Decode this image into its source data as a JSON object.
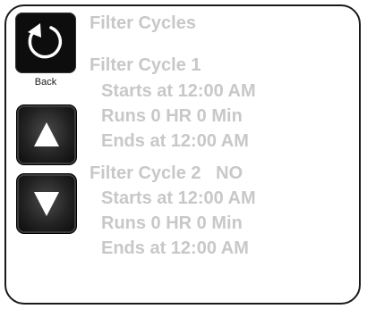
{
  "screen": {
    "title": "Filter Cycles"
  },
  "controls": {
    "back_label": "Back",
    "up_icon": "up-arrow-icon",
    "down_icon": "down-arrow-icon",
    "back_icon": "back-arrow-icon"
  },
  "filter_cycles": [
    {
      "heading": "Filter Cycle 1",
      "starts": "Starts at 12:00 AM",
      "runs": "Runs 0 HR 0 Min",
      "ends": "Ends at 12:00 AM"
    },
    {
      "heading": "Filter Cycle 2   NO",
      "starts": "Starts at 12:00 AM",
      "runs": "Runs 0 HR 0 Min",
      "ends": "Ends at 12:00 AM"
    }
  ],
  "colors": {
    "text": "#c8c8c8",
    "button_bg": "#0d0d0d",
    "frame": "#1a1a1a"
  }
}
